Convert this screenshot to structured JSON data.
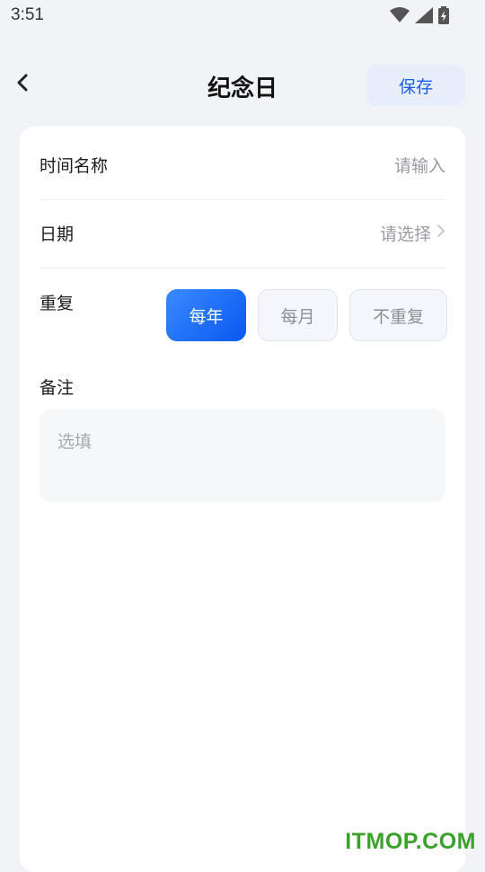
{
  "status_bar": {
    "time": "3:51",
    "icons": [
      "wifi-icon",
      "cellular-signal-icon",
      "battery-charging-icon"
    ]
  },
  "nav": {
    "back_icon": "chevron-left-icon",
    "title": "纪念日",
    "save_label": "保存"
  },
  "form": {
    "name": {
      "label": "时间名称",
      "placeholder": "请输入"
    },
    "date": {
      "label": "日期",
      "placeholder": "请选择",
      "icon": "chevron-right-icon"
    },
    "repeat": {
      "label": "重复",
      "options": [
        {
          "label": "每年",
          "selected": true
        },
        {
          "label": "每月",
          "selected": false
        },
        {
          "label": "不重复",
          "selected": false
        }
      ]
    },
    "note": {
      "label": "备注",
      "placeholder": "选填"
    }
  },
  "colors": {
    "accent": "#1d5ee6",
    "background": "#f2f3f7"
  },
  "watermark": "ITMOP.COM"
}
